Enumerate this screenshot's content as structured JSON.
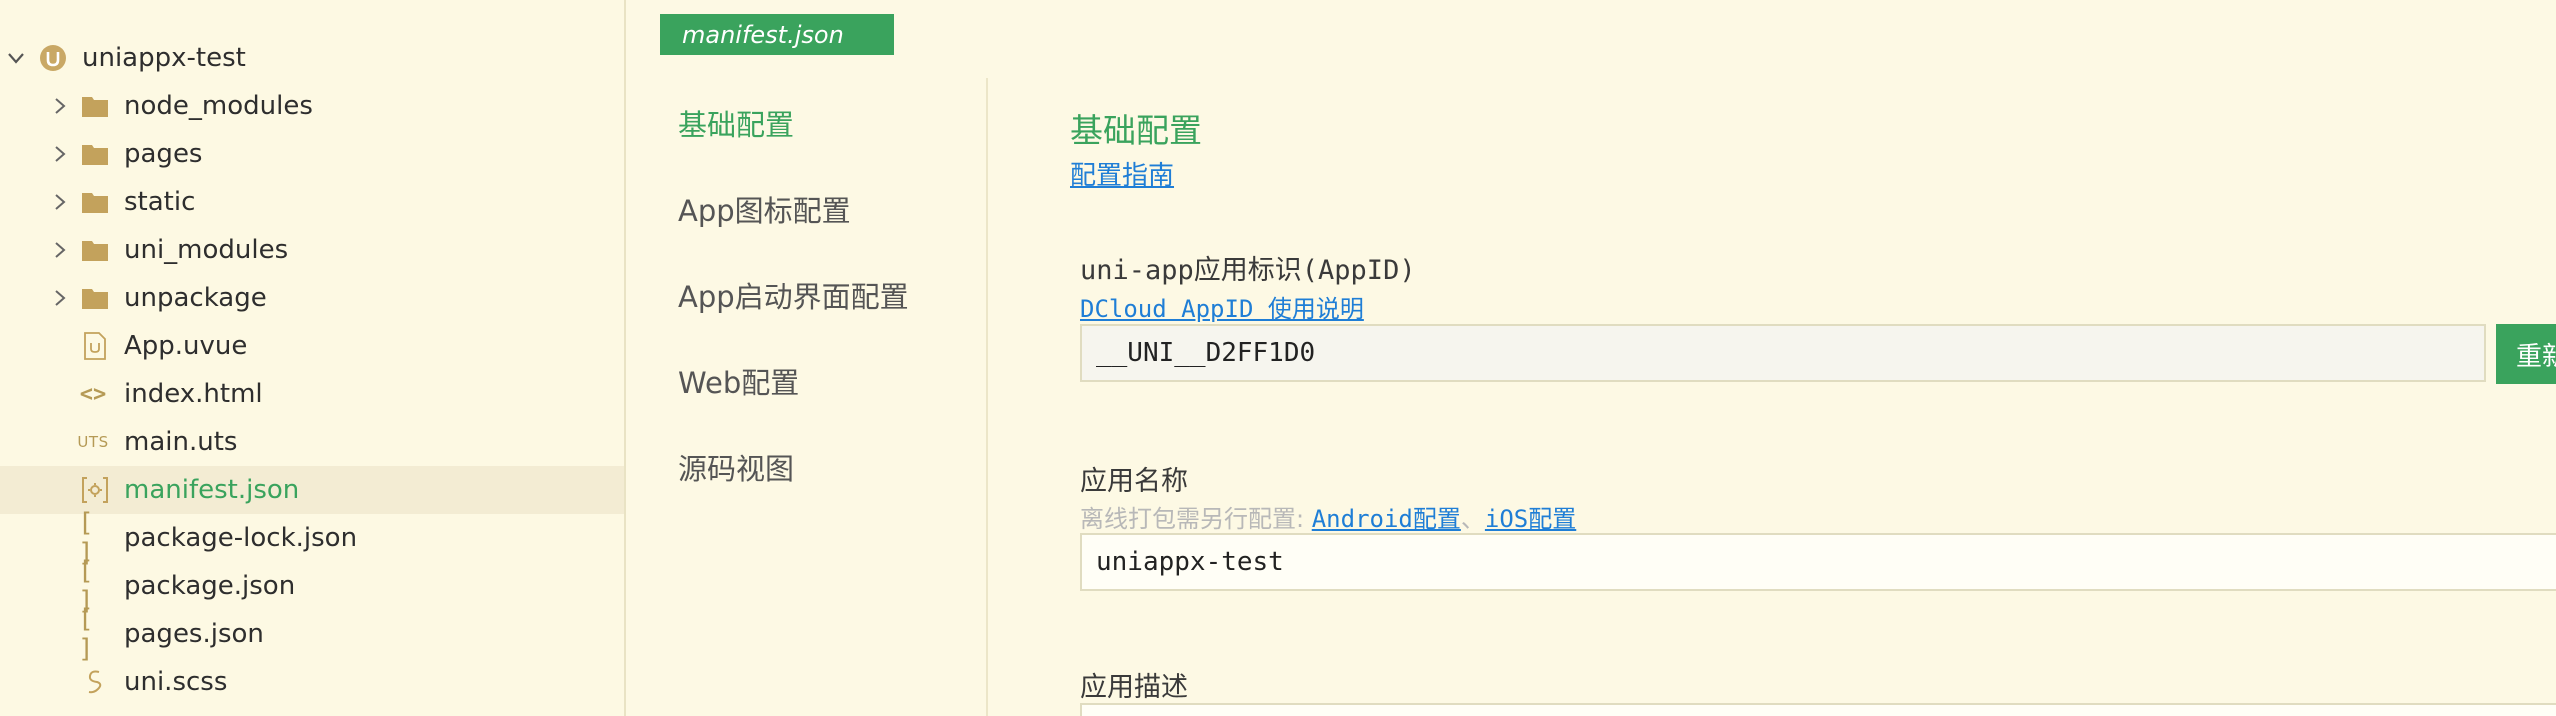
{
  "file_tree": {
    "root": {
      "label": "uniappx-test",
      "icon": "project-icon"
    },
    "items": [
      {
        "label": "node_modules",
        "icon": "folder-icon",
        "type": "folder"
      },
      {
        "label": "pages",
        "icon": "folder-icon",
        "type": "folder"
      },
      {
        "label": "static",
        "icon": "folder-icon",
        "type": "folder"
      },
      {
        "label": "uni_modules",
        "icon": "folder-icon",
        "type": "folder"
      },
      {
        "label": "unpackage",
        "icon": "folder-icon",
        "type": "folder"
      },
      {
        "label": "App.uvue",
        "icon": "uvue-file-icon",
        "type": "file"
      },
      {
        "label": "index.html",
        "icon": "html-file-icon",
        "type": "file"
      },
      {
        "label": "main.uts",
        "icon": "uts-file-icon",
        "type": "file",
        "icon_text": "UTS"
      },
      {
        "label": "manifest.json",
        "icon": "manifest-file-icon",
        "type": "file",
        "active": true
      },
      {
        "label": "package-lock.json",
        "icon": "json-file-icon",
        "type": "file",
        "icon_text": "[ ]"
      },
      {
        "label": "package.json",
        "icon": "json-file-icon",
        "type": "file",
        "icon_text": "[ ]"
      },
      {
        "label": "pages.json",
        "icon": "json-file-icon",
        "type": "file",
        "icon_text": "[ ]"
      },
      {
        "label": "uni.scss",
        "icon": "scss-file-icon",
        "type": "file"
      }
    ]
  },
  "editor": {
    "tab_label": "manifest.json"
  },
  "config_nav": {
    "items": [
      {
        "label": "基础配置",
        "active": true
      },
      {
        "label": "App图标配置"
      },
      {
        "label": "App启动界面配置"
      },
      {
        "label": "Web配置"
      },
      {
        "label": "源码视图"
      }
    ]
  },
  "basic_config": {
    "title": "基础配置",
    "guide_link": "配置指南",
    "appid": {
      "label": "uni-app应用标识(AppID)",
      "help_link": "DCloud AppID 使用说明",
      "value": "__UNI__D2FF1D0",
      "regen_button": "重新"
    },
    "app_name": {
      "label": "应用名称",
      "hint_prefix": "离线打包需另行配置:",
      "android_link": "Android配置",
      "separator": "、",
      "ios_link": "iOS配置",
      "value": "uniappx-test"
    },
    "app_desc": {
      "label": "应用描述"
    }
  },
  "colors": {
    "accent": "#3aa35d",
    "link": "#1f7ed6",
    "background": "#fdf9e4",
    "active_row": "#f3ecd3",
    "icon_gold": "#c3a25c"
  }
}
